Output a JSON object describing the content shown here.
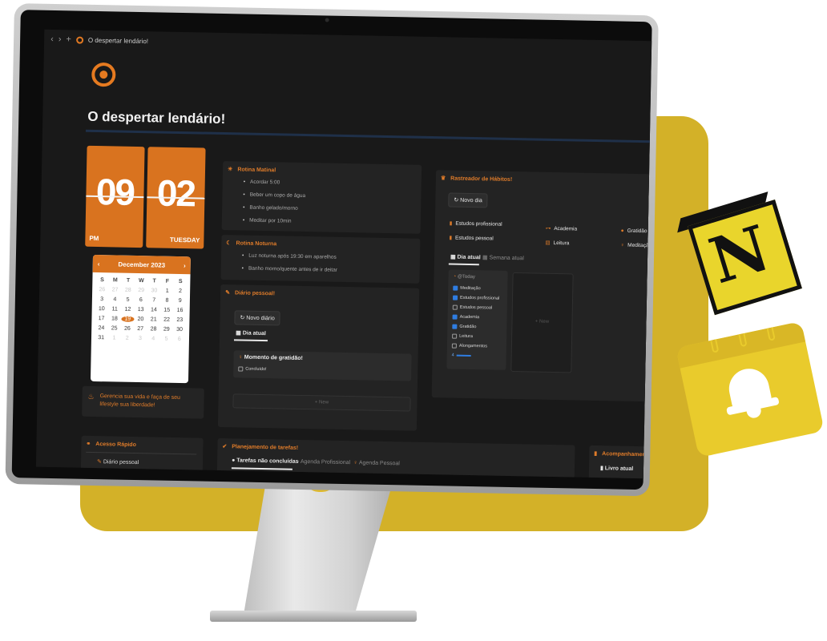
{
  "window": {
    "tab_title": "O despertar lendário!"
  },
  "page": {
    "title": "O despertar lendário!"
  },
  "clock": {
    "hour": "09",
    "minute": "02",
    "ampm": "PM",
    "weekday": "TUESDAY"
  },
  "calendar": {
    "month_label": "December 2023",
    "prev": "‹",
    "next": "›",
    "dow": [
      "S",
      "M",
      "T",
      "W",
      "T",
      "F",
      "S"
    ],
    "rows": [
      [
        "26",
        "27",
        "28",
        "29",
        "30",
        "1",
        "2"
      ],
      [
        "3",
        "4",
        "5",
        "6",
        "7",
        "8",
        "9"
      ],
      [
        "10",
        "11",
        "12",
        "13",
        "14",
        "15",
        "16"
      ],
      [
        "17",
        "18",
        "19",
        "20",
        "21",
        "22",
        "23"
      ],
      [
        "24",
        "25",
        "26",
        "27",
        "28",
        "29",
        "30"
      ],
      [
        "31",
        "1",
        "2",
        "3",
        "4",
        "5",
        "6"
      ]
    ],
    "today": "19"
  },
  "blurb": {
    "text": "Gerencia sua vida e faça de seu lifestyle sua liberdade!"
  },
  "rotina_matinal": {
    "title": "Rotina Matinal",
    "items": [
      "Acordar 5:00",
      "Beber um copo de água",
      "Banho gelado/morno",
      "Meditar por 10min"
    ]
  },
  "rotina_noturna": {
    "title": "Rotina Noturna",
    "items": [
      "Luz noturna após 19:30 em aparelhos",
      "Banho morno/quente antes de ir deitar"
    ]
  },
  "diario": {
    "title": "Diário pessoal!",
    "new_button": "Novo diário",
    "tab": "Dia atual",
    "card_title": "Momento de gratidão!",
    "card_check": "Concluído!",
    "new_row": "+ New"
  },
  "habitos": {
    "title": "Rastreador de Hábitos!",
    "new_button": "Novo dia",
    "chips": [
      "Estudos profissional",
      "Estudos pessoal",
      "Academia",
      "Leitura",
      "Gratidão",
      "Meditação"
    ],
    "tab_active": "Dia atual",
    "tab_other": "Semana atual",
    "card_title": "@Today",
    "checklist": [
      {
        "label": "Meditação",
        "checked": true
      },
      {
        "label": "Estudos profissional",
        "checked": true
      },
      {
        "label": "Estudos pessoal",
        "checked": false
      },
      {
        "label": "Academia",
        "checked": true
      },
      {
        "label": "Gratidão",
        "checked": true
      },
      {
        "label": "Leitura",
        "checked": false
      },
      {
        "label": "Alongamentos",
        "checked": false
      }
    ],
    "progress_value": "4",
    "new_card": "+ New"
  },
  "acesso": {
    "title": "Acesso Rápido",
    "item": "Diário pessoal"
  },
  "planejamento": {
    "title": "Planejamento de tarefas!",
    "tabs": [
      "Tarefas não concluídas",
      "Agenda Profissional",
      "Agenda Pessoal"
    ]
  },
  "acompanhamento": {
    "title": "Acompanhamento d",
    "tab": "Livro atual"
  },
  "notion_badge": {
    "letter": "N"
  },
  "colors": {
    "accent": "#d9731f",
    "screen_bg": "#191919",
    "panel_bg": "#232323",
    "backdrop": "#d3b128"
  }
}
